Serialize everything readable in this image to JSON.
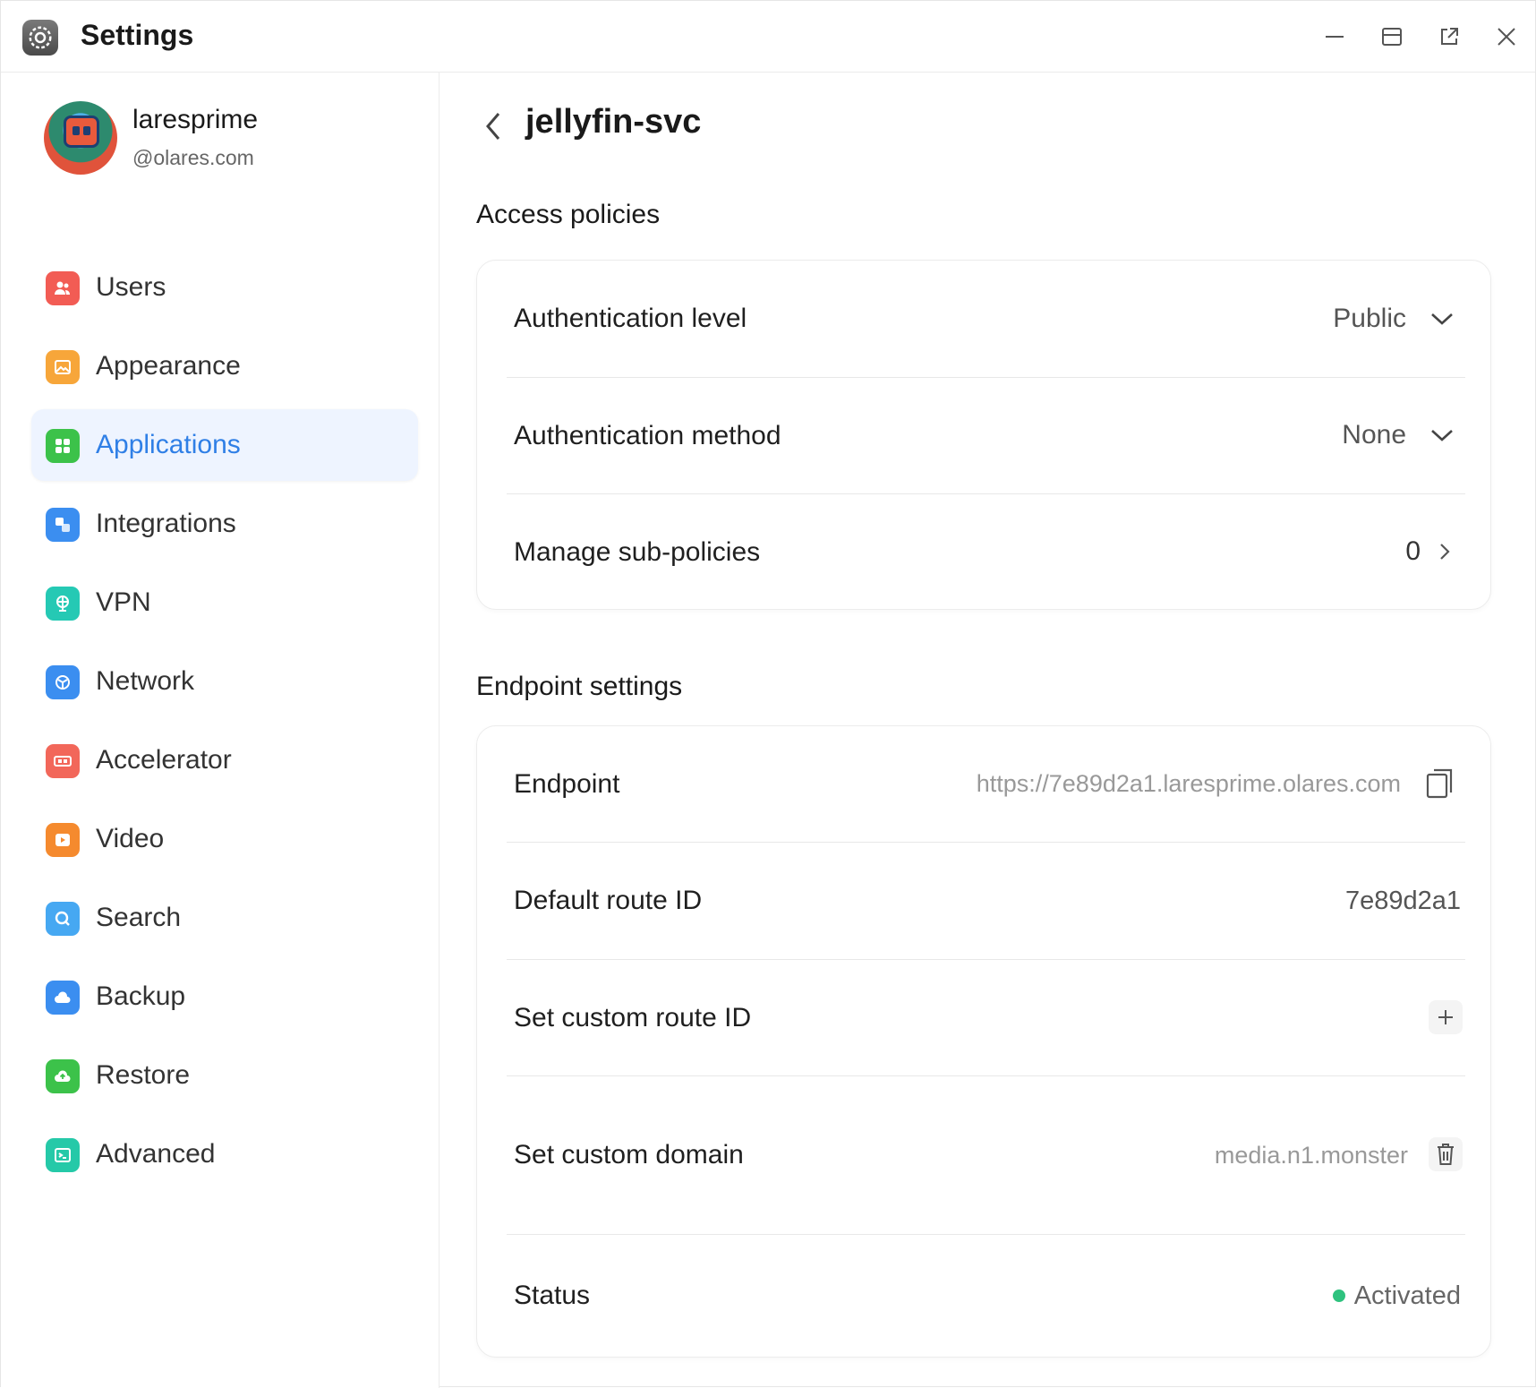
{
  "window": {
    "title": "Settings"
  },
  "profile": {
    "name": "laresprime",
    "domain": "@olares.com"
  },
  "sidebar": {
    "items": [
      {
        "label": "Users",
        "icon": "users-icon",
        "color": "#f25c54",
        "active": false
      },
      {
        "label": "Appearance",
        "icon": "appearance-icon",
        "color": "#f7a63a",
        "active": false
      },
      {
        "label": "Applications",
        "icon": "applications-icon",
        "color": "#3cc24a",
        "active": true
      },
      {
        "label": "Integrations",
        "icon": "integrations-icon",
        "color": "#3b8ef0",
        "active": false
      },
      {
        "label": "VPN",
        "icon": "vpn-icon",
        "color": "#25c9b4",
        "active": false
      },
      {
        "label": "Network",
        "icon": "network-icon",
        "color": "#3b8ef0",
        "active": false
      },
      {
        "label": "Accelerator",
        "icon": "accelerator-icon",
        "color": "#f2675a",
        "active": false
      },
      {
        "label": "Video",
        "icon": "video-icon",
        "color": "#f58a2e",
        "active": false
      },
      {
        "label": "Search",
        "icon": "search-icon",
        "color": "#46a8f2",
        "active": false
      },
      {
        "label": "Backup",
        "icon": "backup-icon",
        "color": "#3b8ef0",
        "active": false
      },
      {
        "label": "Restore",
        "icon": "restore-icon",
        "color": "#3cc24a",
        "active": false
      },
      {
        "label": "Advanced",
        "icon": "advanced-icon",
        "color": "#25c9a8",
        "active": false
      }
    ]
  },
  "main": {
    "title": "jellyfin-svc",
    "access": {
      "heading": "Access policies",
      "auth_level_label": "Authentication level",
      "auth_level_value": "Public",
      "auth_method_label": "Authentication method",
      "auth_method_value": "None",
      "sub_policies_label": "Manage sub-policies",
      "sub_policies_count": "0"
    },
    "endpoint": {
      "heading": "Endpoint settings",
      "endpoint_label": "Endpoint",
      "endpoint_value": "https://7e89d2a1.laresprime.olares.com",
      "route_id_label": "Default route ID",
      "route_id_value": "7e89d2a1",
      "custom_route_label": "Set custom route ID",
      "custom_domain_label": "Set custom domain",
      "custom_domain_value": "media.n1.monster",
      "status_label": "Status",
      "status_value": "Activated",
      "status_color": "#2ec27e"
    }
  },
  "colors": {
    "accent": "#2f7fe6",
    "active_bg": "#eef4ff"
  }
}
